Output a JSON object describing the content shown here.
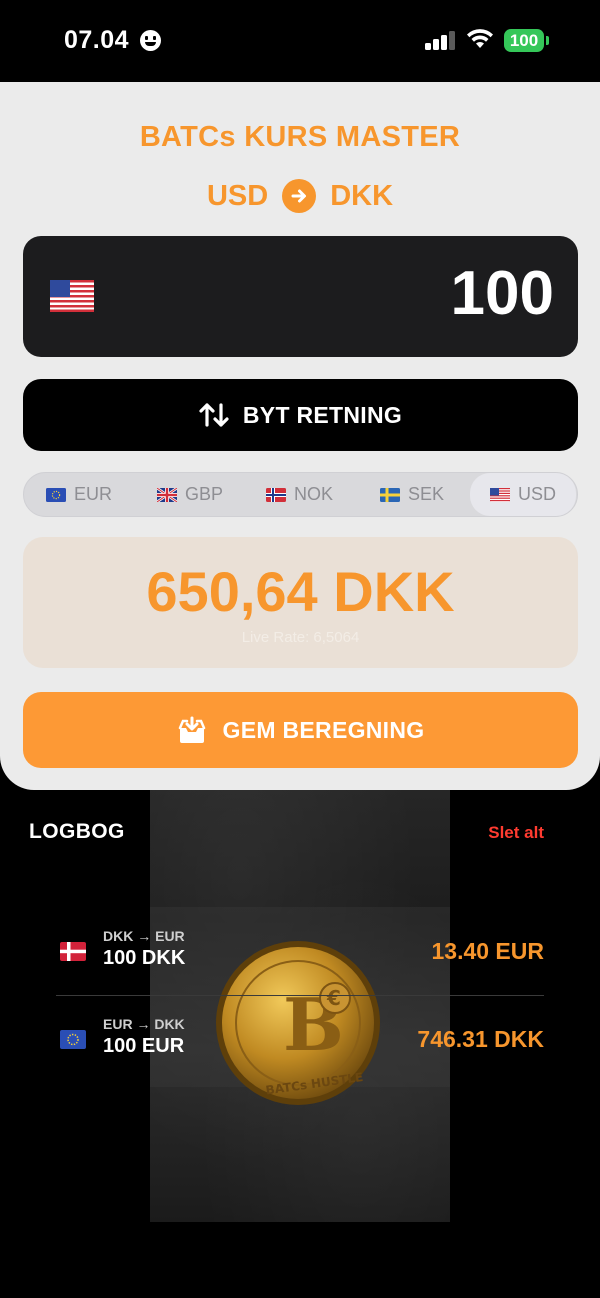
{
  "status_bar": {
    "time": "07.04",
    "battery": "100"
  },
  "app": {
    "title": "BATCs KURS MASTER"
  },
  "pair": {
    "from": "USD",
    "to": "DKK"
  },
  "input": {
    "amount": "100",
    "flag": "us-flag-icon"
  },
  "swap_button": {
    "label": "BYT RETNING"
  },
  "currencies": [
    {
      "code": "EUR",
      "flag": "eu-flag-icon",
      "selected": false
    },
    {
      "code": "GBP",
      "flag": "uk-flag-icon",
      "selected": false
    },
    {
      "code": "NOK",
      "flag": "norway-flag-icon",
      "selected": false
    },
    {
      "code": "SEK",
      "flag": "sweden-flag-icon",
      "selected": false
    },
    {
      "code": "USD",
      "flag": "us-flag-icon",
      "selected": true
    }
  ],
  "result": {
    "value": "650,64 DKK",
    "rate_text": "Live Rate: 6,5064"
  },
  "save_button": {
    "label": "GEM BEREGNING"
  },
  "log": {
    "title": "LOGBOG",
    "clear_label": "Slet alt",
    "entries": [
      {
        "pair": "DKK → EUR",
        "amount": "100 DKK",
        "result": "13.40 EUR",
        "flag": "denmark-flag-icon"
      },
      {
        "pair": "EUR → DKK",
        "amount": "100 EUR",
        "result": "746.31 DKK",
        "flag": "eu-flag-icon"
      }
    ]
  },
  "colors": {
    "accent": "#f7962d",
    "panel": "#ebebeb",
    "danger": "#ff3b30"
  }
}
